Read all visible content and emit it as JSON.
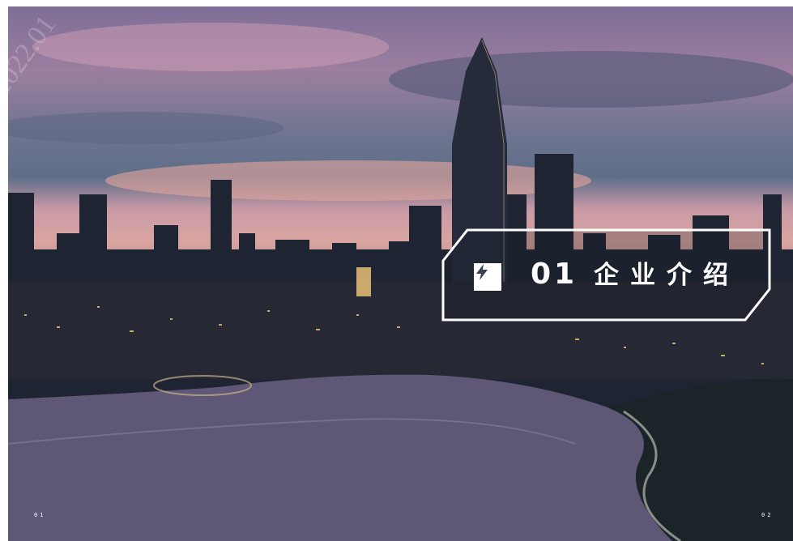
{
  "section": {
    "number": "01",
    "title": "企业介绍",
    "icon": "lightning-bolt-icon"
  },
  "watermark": {
    "text": "2022.01"
  },
  "page_numbers": {
    "left": "01",
    "right": "02"
  },
  "colors": {
    "accent": "#ffffff",
    "sky_pink": "#d9a5a0",
    "water": "#6a5d78"
  }
}
